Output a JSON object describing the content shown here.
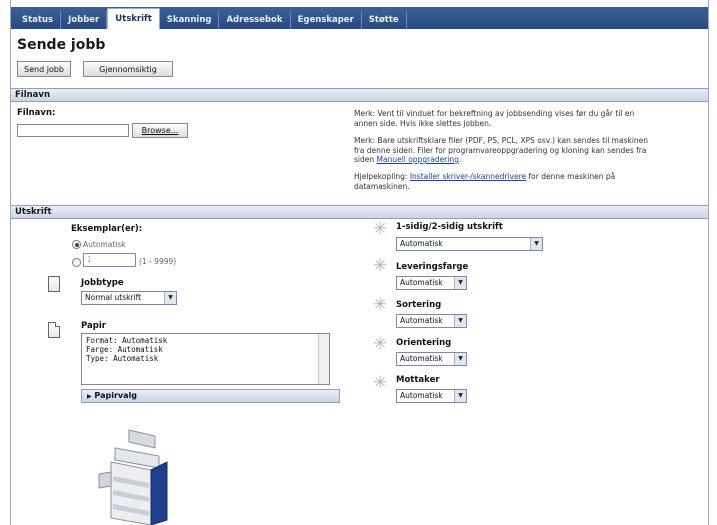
{
  "tabs": [
    {
      "label": "Status",
      "active": false
    },
    {
      "label": "Jobber",
      "active": false
    },
    {
      "label": "Utskrift",
      "active": true
    },
    {
      "label": "Skanning",
      "active": false
    },
    {
      "label": "Adressebok",
      "active": false
    },
    {
      "label": "Egenskaper",
      "active": false
    },
    {
      "label": "Støtte",
      "active": false
    }
  ],
  "page": {
    "title": "Sende jobb",
    "send_button": "Send jobb",
    "reset_button": "Gjennomsiktig"
  },
  "filename_section": {
    "header": "Filnavn",
    "label": "Filnavn:",
    "browse_button": "Browse...",
    "note1": "Merk: Vent til vinduet for bekreftning av jobbsending vises før du går til en annen side. Hvis ikke slettes jobben.",
    "note2": "Merk: Bare utskriftsklare filer (PDF, PS, PCL, XPS osv.) kan sendes til maskinen fra denne siden. Filer for programvareoppgradering og kloning kan sendes fra siden",
    "note2_link": "Manuell oppgradering",
    "note2_end": ".",
    "help_prefix": "Hjelpekopling:",
    "help_link": "Installer skriver-/skannedrivere",
    "help_suffix": "for denne maskinen på datamaskinen."
  },
  "print_section": {
    "header": "Utskrift",
    "copies": {
      "label": "Eksemplar(er):",
      "auto_label": "Automatisk",
      "value": "1",
      "range": "(1 - 9999)"
    },
    "job_type": {
      "label": "Jobbtype",
      "value": "Normal utskrift"
    },
    "paper": {
      "label": "Papir",
      "lines": [
        "Format: Automatisk",
        "Farge: Automatisk",
        "Type: Automatisk"
      ],
      "options_button": "Papirvalg"
    },
    "sided": {
      "label": "1-sidig/2-sidig utskrift",
      "value": "Automatisk"
    },
    "output_color": {
      "label": "Leveringsfarge",
      "value": "Automatisk"
    },
    "collation": {
      "label": "Sortering",
      "value": "Automatisk"
    },
    "orientation": {
      "label": "Orientering",
      "value": "Automatisk"
    },
    "destination": {
      "label": "Mottaker",
      "value": "Automatisk"
    }
  }
}
